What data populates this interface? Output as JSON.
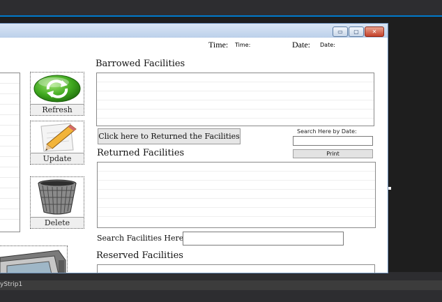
{
  "window": {
    "buttons": {
      "minimize": "▭",
      "maximize": "▢",
      "close": "✕"
    }
  },
  "header": {
    "time_label": "Time:",
    "time_value": "Time:",
    "date_label": "Date:",
    "date_value": "Date:"
  },
  "actions": {
    "refresh_label": "Refresh",
    "update_label": "Update",
    "delete_label": "Delete"
  },
  "sections": {
    "borrowed_title": "Barrowed Facilities",
    "returned_title": "Returned Facilities",
    "reserved_title": "Reserved Facilities"
  },
  "return_button_label": "Click here to Returned the Facilities",
  "search_by_date": {
    "label": "Search Here by Date:",
    "value": ""
  },
  "print_label": "Print",
  "search_facilities": {
    "label": "Search Facilities Here:",
    "value": ""
  },
  "ide": {
    "bottom_text": "yStrip1"
  },
  "icons": {
    "refresh": "refresh-arrows-icon",
    "update": "pencil-paper-icon",
    "delete": "trash-bin-icon"
  }
}
